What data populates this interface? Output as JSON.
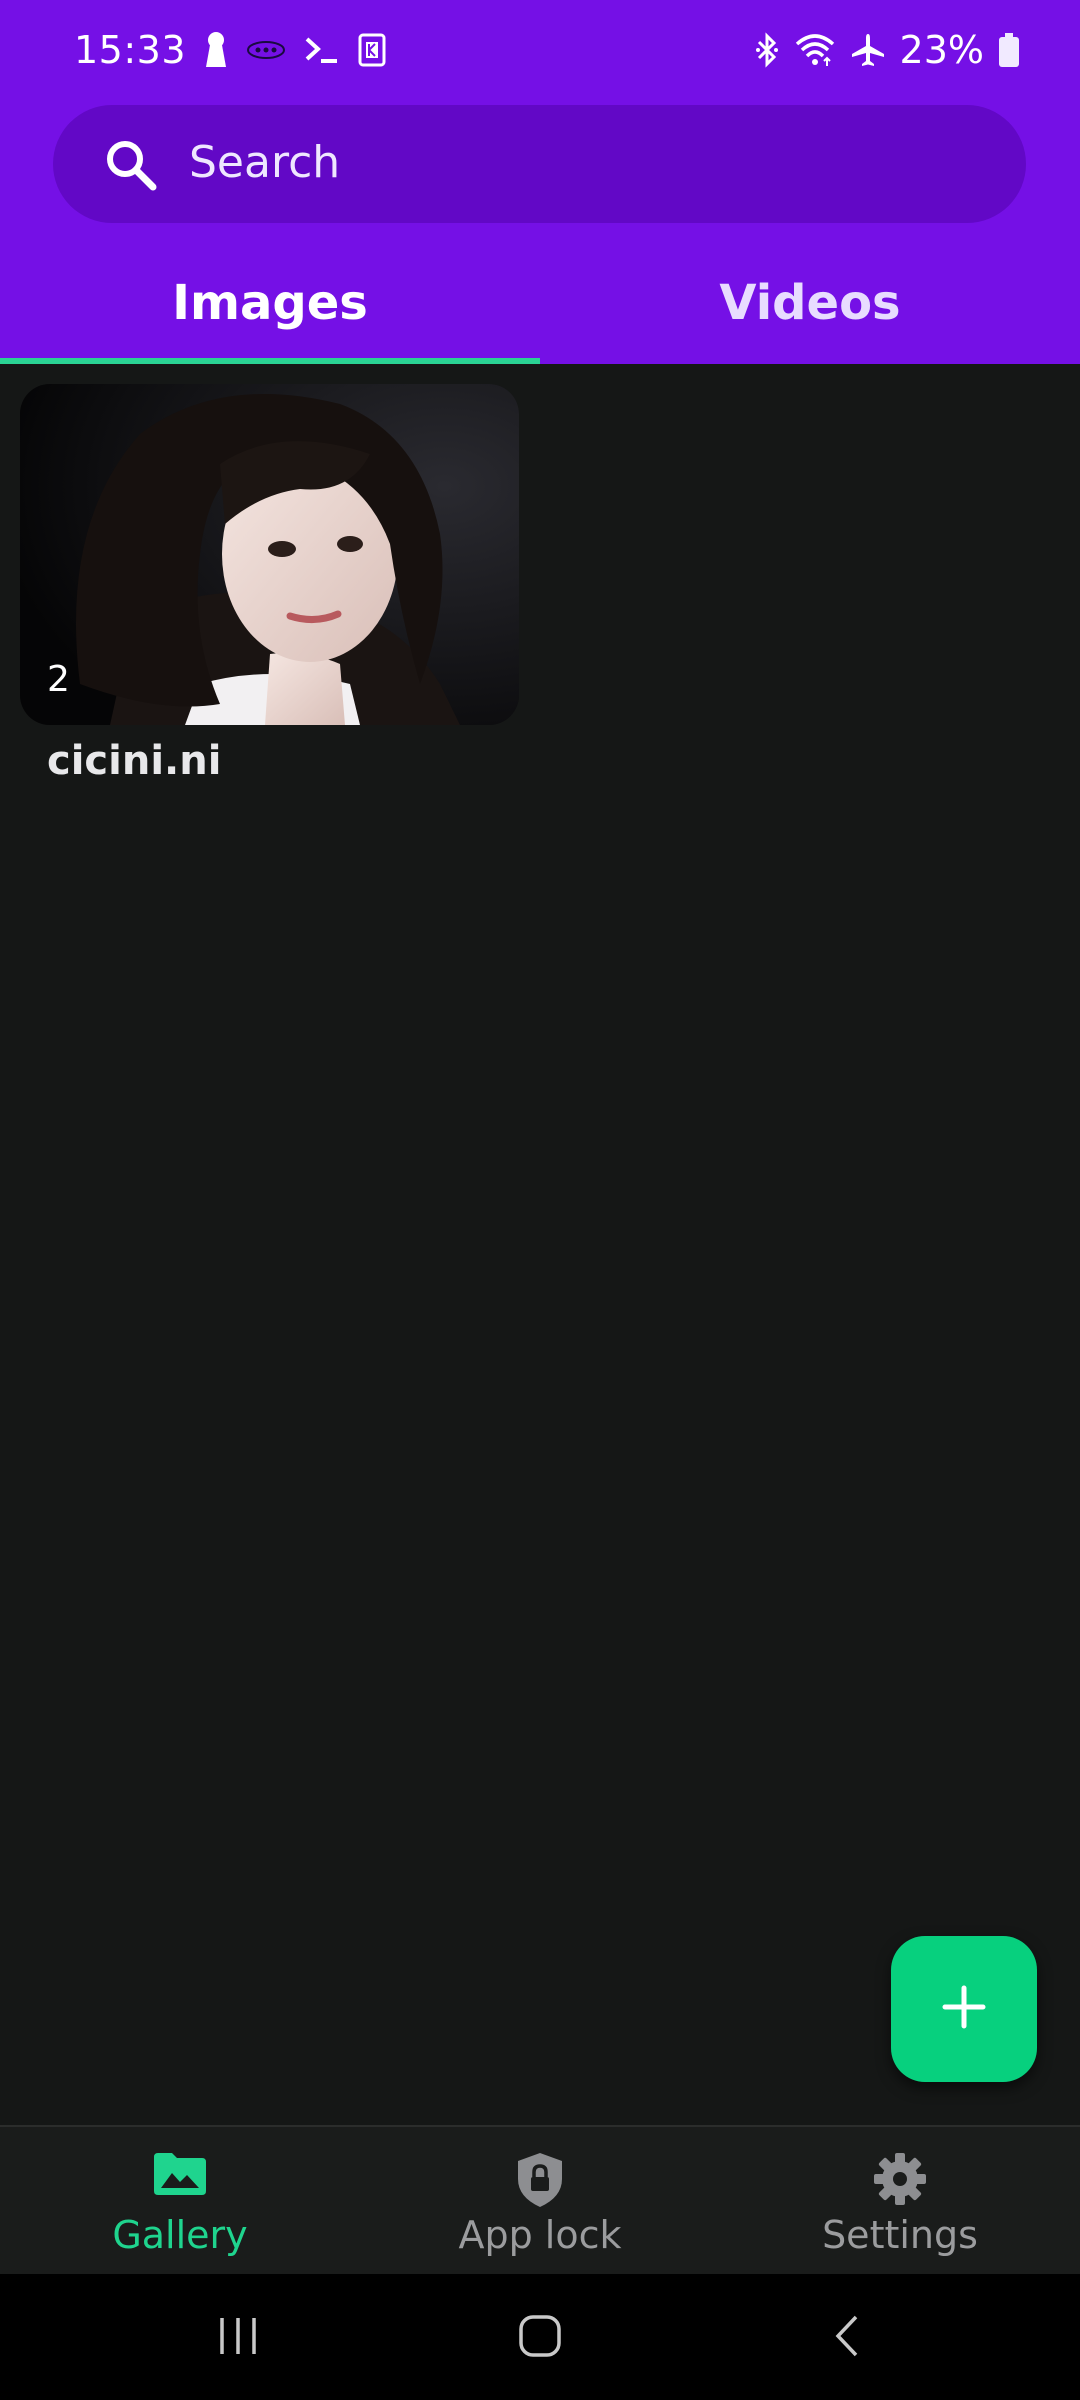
{
  "status_bar": {
    "time": "15:33",
    "battery": "23%",
    "left_icons": [
      "keyhole-icon",
      "chat-dots-icon",
      "terminal-icon",
      "k-app-icon"
    ],
    "right_icons": [
      "bluetooth-icon",
      "wifi-icon",
      "airplane-icon",
      "battery-icon"
    ]
  },
  "search": {
    "placeholder": "Search",
    "icon": "search-icon"
  },
  "tabs": [
    {
      "label": "Images",
      "active": true
    },
    {
      "label": "Videos",
      "active": false
    }
  ],
  "albums": [
    {
      "name": "cicini.ni",
      "count": "2"
    }
  ],
  "fab": {
    "icon": "plus-icon"
  },
  "bottom_nav": [
    {
      "label": "Gallery",
      "icon": "image-folder-icon",
      "active": true
    },
    {
      "label": "App lock",
      "icon": "shield-lock-icon",
      "active": false
    },
    {
      "label": "Settings",
      "icon": "gear-icon",
      "active": false
    }
  ],
  "system_nav": [
    "recents-button",
    "home-button",
    "back-button"
  ],
  "colors": {
    "header": "#7510e6",
    "search_bg": "#6208c6",
    "accent": "#07d07e",
    "background": "#151716"
  }
}
